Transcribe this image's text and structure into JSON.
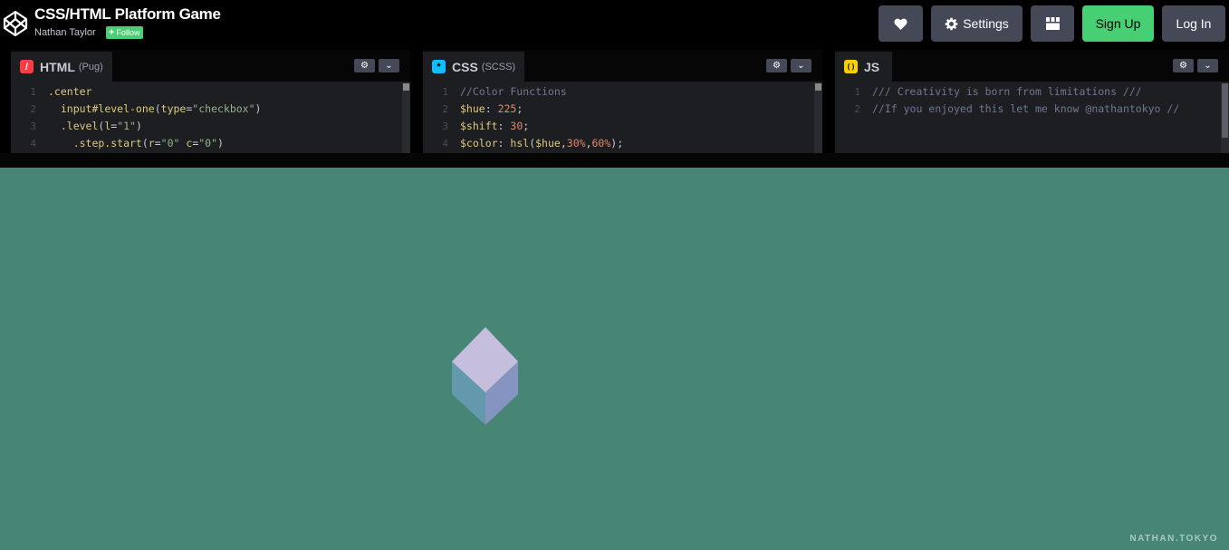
{
  "header": {
    "title": "CSS/HTML Platform Game",
    "author": "Nathan Taylor",
    "follow_label": "Follow",
    "follow_plus": "+",
    "buttons": {
      "settings_label": "Settings",
      "signup_label": "Sign Up",
      "login_label": "Log In"
    }
  },
  "editors": {
    "html": {
      "badge": "/",
      "badge_color": "#ff3c41",
      "lang": "HTML",
      "preprocessor": "(Pug)",
      "lines": [
        {
          "n": "1",
          "parts": [
            {
              "t": ".center",
              "c": "cls"
            }
          ]
        },
        {
          "n": "2",
          "parts": [
            {
              "t": "  input",
              "c": "cls"
            },
            {
              "t": "#level-one",
              "c": "id"
            },
            {
              "t": "(",
              "c": "plain"
            },
            {
              "t": "type",
              "c": "cls"
            },
            {
              "t": "=",
              "c": "plain"
            },
            {
              "t": "\"checkbox\"",
              "c": "str"
            },
            {
              "t": ")",
              "c": "plain"
            }
          ]
        },
        {
          "n": "3",
          "parts": [
            {
              "t": "  .level",
              "c": "cls"
            },
            {
              "t": "(",
              "c": "plain"
            },
            {
              "t": "l",
              "c": "cls"
            },
            {
              "t": "=",
              "c": "plain"
            },
            {
              "t": "\"1\"",
              "c": "str"
            },
            {
              "t": ")",
              "c": "plain"
            }
          ]
        },
        {
          "n": "4",
          "parts": [
            {
              "t": "    .step.start",
              "c": "cls"
            },
            {
              "t": "(",
              "c": "plain"
            },
            {
              "t": "r",
              "c": "cls"
            },
            {
              "t": "=",
              "c": "plain"
            },
            {
              "t": "\"0\"",
              "c": "str"
            },
            {
              "t": " c",
              "c": "cls"
            },
            {
              "t": "=",
              "c": "plain"
            },
            {
              "t": "\"0\"",
              "c": "str"
            },
            {
              "t": ")",
              "c": "plain"
            }
          ]
        }
      ]
    },
    "css": {
      "badge": "*",
      "badge_color": "#0ebeff",
      "lang": "CSS",
      "preprocessor": "(SCSS)",
      "lines": [
        {
          "n": "1",
          "parts": [
            {
              "t": "//Color Functions",
              "c": "com"
            }
          ]
        },
        {
          "n": "2",
          "parts": [
            {
              "t": "$hue",
              "c": "fn"
            },
            {
              "t": ": ",
              "c": "plain"
            },
            {
              "t": "225",
              "c": "num"
            },
            {
              "t": ";",
              "c": "plain"
            }
          ]
        },
        {
          "n": "3",
          "parts": [
            {
              "t": "$shift",
              "c": "fn"
            },
            {
              "t": ": ",
              "c": "plain"
            },
            {
              "t": "30",
              "c": "num"
            },
            {
              "t": ";",
              "c": "plain"
            }
          ]
        },
        {
          "n": "4",
          "parts": [
            {
              "t": "$color",
              "c": "fn"
            },
            {
              "t": ": ",
              "c": "plain"
            },
            {
              "t": "hsl",
              "c": "fn"
            },
            {
              "t": "(",
              "c": "plain"
            },
            {
              "t": "$hue",
              "c": "fn"
            },
            {
              "t": ",",
              "c": "plain"
            },
            {
              "t": "30%",
              "c": "num"
            },
            {
              "t": ",",
              "c": "plain"
            },
            {
              "t": "60%",
              "c": "num"
            },
            {
              "t": ");",
              "c": "plain"
            }
          ]
        }
      ]
    },
    "js": {
      "badge": "( )",
      "badge_color": "#fcd000",
      "lang": "JS",
      "preprocessor": "",
      "lines": [
        {
          "n": "1",
          "parts": [
            {
              "t": "/// Creativity is born from limitations ///",
              "c": "com"
            }
          ]
        },
        {
          "n": "2",
          "parts": [
            {
              "t": "//If you enjoyed this let me know @nathantokyo //",
              "c": "com"
            }
          ]
        }
      ]
    }
  },
  "preview": {
    "background": "#478674",
    "watermark": "NATHAN.TOKYO",
    "cube_colors": {
      "top": "#c5bfdd",
      "left": "#6498ad",
      "right": "#8694c2"
    }
  }
}
